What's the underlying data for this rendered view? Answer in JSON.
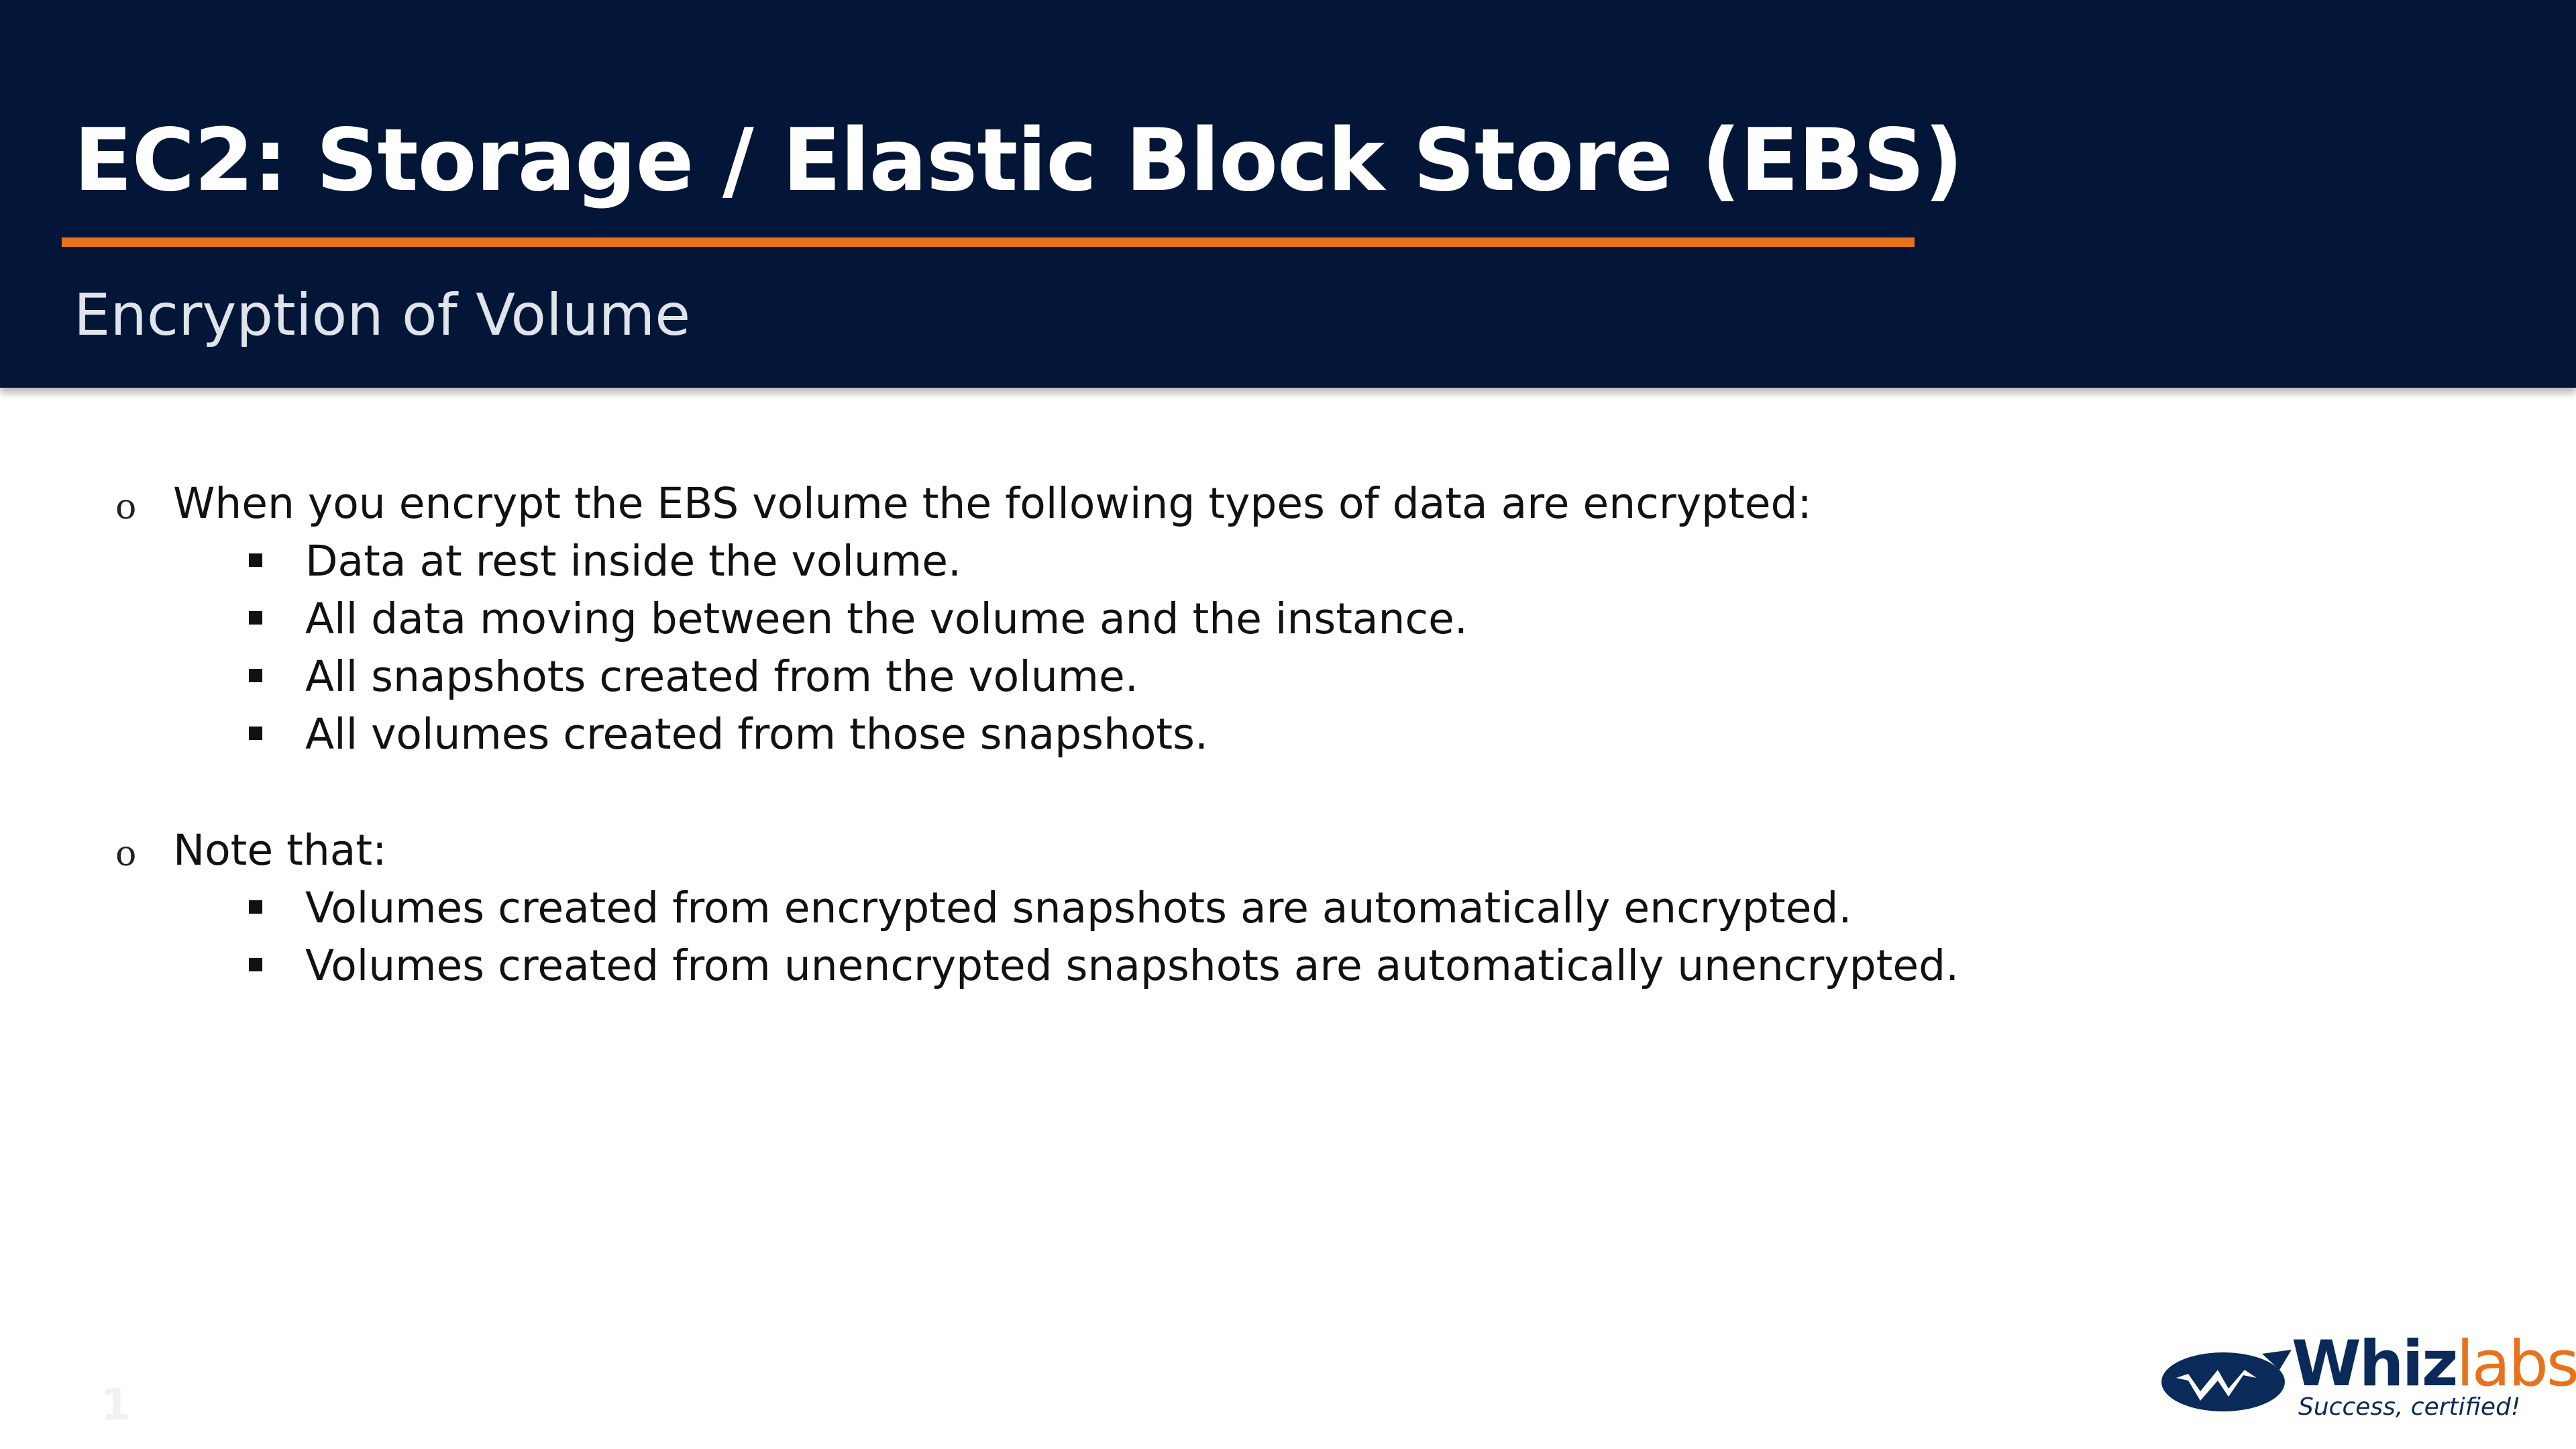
{
  "header": {
    "title": "EC2: Storage / Elastic Block Store (EBS)",
    "subtitle": "Encryption of Volume"
  },
  "bullets": [
    {
      "text": "When you encrypt the EBS volume the following types of data are encrypted:",
      "subitems": [
        "Data at rest inside the volume.",
        "All data moving between the volume and the instance.",
        "All snapshots created from the volume.",
        "All volumes created from those snapshots."
      ]
    },
    {
      "text": "Note that:",
      "subitems": [
        "Volumes created from encrypted snapshots are automatically encrypted.",
        "Volumes created from unencrypted snapshots are automatically unencrypted."
      ]
    }
  ],
  "markers": {
    "level1": "o"
  },
  "footer": {
    "page_number": "1",
    "logo_name_main": "Whiz",
    "logo_name_accent": "labs",
    "logo_tagline": "Success, certified!"
  },
  "colors": {
    "header_background": "#031637",
    "title_rule": "#e8721c",
    "title_text": "#ffffff",
    "subtitle_text": "#dfe3ea",
    "logo_navy": "#0a2a59",
    "logo_orange": "#e8721c"
  }
}
